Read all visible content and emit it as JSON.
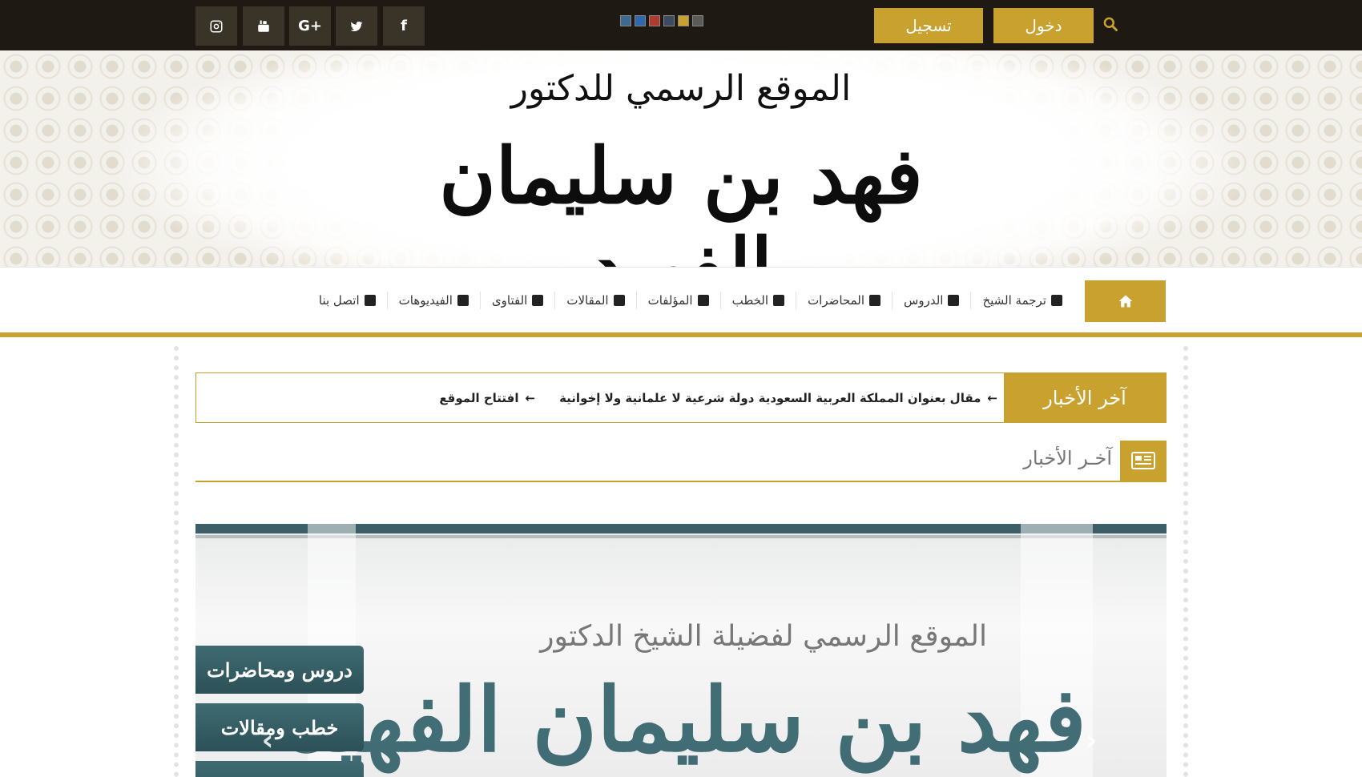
{
  "topbar": {
    "social": [
      {
        "name": "instagram"
      },
      {
        "name": "youtube"
      },
      {
        "name": "google-plus",
        "label": "G+"
      },
      {
        "name": "twitter"
      },
      {
        "name": "facebook",
        "label": "f"
      }
    ],
    "color_swatches": [
      "#3f6a8f",
      "#2e69b0",
      "#b03a2e",
      "#3d4a63",
      "#c9a12e",
      "#5a5a5a"
    ],
    "register_label": "تسجيل",
    "login_label": "دخول",
    "search_icon": "search-icon",
    "accent_color": "#c9a12e",
    "bar_color": "#1e1a13"
  },
  "header": {
    "subtitle": "الموقع الرسمي للدكتور",
    "title": "فهد بن سليمان الفهيد"
  },
  "nav": {
    "home_icon": "home-icon",
    "items": [
      {
        "label": "ترجمة الشيخ",
        "icon": "user-book-icon"
      },
      {
        "label": "الدروس",
        "icon": "folder-open-icon"
      },
      {
        "label": "المحاضرات",
        "icon": "tags-icon"
      },
      {
        "label": "الخطب",
        "icon": "leaf-icon"
      },
      {
        "label": "المؤلفات",
        "icon": "book-icon"
      },
      {
        "label": "المقالات",
        "icon": "edit-icon"
      },
      {
        "label": "الفتاوى",
        "icon": "comments-icon"
      },
      {
        "label": "الفيديوهات",
        "icon": "video-camera-icon"
      },
      {
        "label": "اتصل بنا",
        "icon": "envelope-icon"
      }
    ]
  },
  "ticker": {
    "label": "آخر الأخبار",
    "items": [
      "مقال بعنوان المملكة العربية السعودية دولة شرعية لا علمانية ولا إخوانية",
      "افتتاح الموقع"
    ]
  },
  "section": {
    "title": "آخـر الأخبار",
    "icon": "newspaper-icon"
  },
  "slider": {
    "subtitle": "الموقع الرسمي لفضيلة الشيخ الدكتور",
    "title": "فهد بن سليمان الفهيد",
    "tabs": [
      "دروس ومحاضرات",
      "خطب ومقالات"
    ],
    "prev_icon": "chevron-left-icon",
    "next_icon": "chevron-right-icon"
  }
}
